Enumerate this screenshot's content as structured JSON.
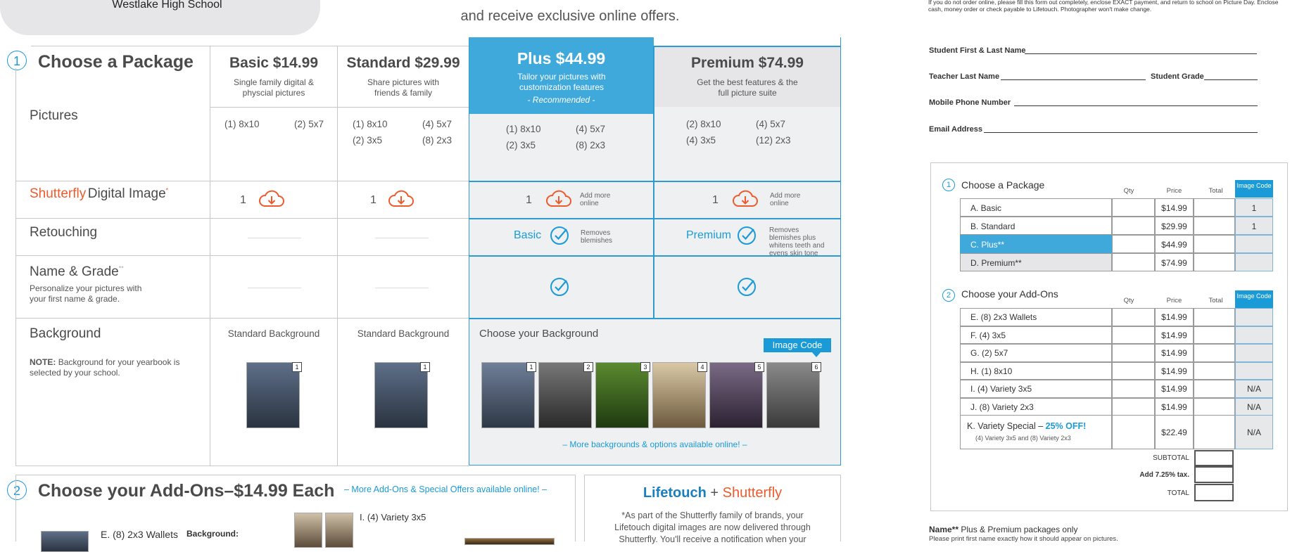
{
  "header": {
    "school": "Westlake High School",
    "subtitle": "and receive exclusive online offers."
  },
  "section1": {
    "num": "1",
    "title": "Choose a Package",
    "rows": {
      "pictures": "Pictures",
      "digital_brand": "Shutterfly",
      "digital_label": "Digital Image",
      "retouching": "Retouching",
      "name_grade": "Name & Grade",
      "name_grade_desc": "Personalize your pictures with your first name & grade.",
      "background": "Background",
      "bg_note_bold": "NOTE:",
      "bg_note": "Background for your yearbook is selected by your school."
    },
    "packages": [
      {
        "title": "Basic $14.99",
        "desc": "Single family digital & physcial pictures",
        "pics": [
          "(1) 8x10",
          "(2) 5x7"
        ],
        "digital": "1"
      },
      {
        "title": "Standard $29.99",
        "desc": "Share pictures with friends & family",
        "pics": [
          "(1) 8x10",
          "(4) 5x7",
          "(2) 3x5",
          "(8) 2x3"
        ],
        "digital": "1"
      },
      {
        "title": "Plus $44.99",
        "desc": "Tailor your pictures with customization features",
        "recommended": "- Recommended -",
        "pics": [
          "(1) 8x10",
          "(4) 5x7",
          "(2) 3x5",
          "(8) 2x3"
        ],
        "digital": "1",
        "add_more": "Add more online",
        "retouch": "Basic",
        "retouch_desc": "Removes blemishes"
      },
      {
        "title": "Premium $74.99",
        "desc": "Get the best features & the full picture suite",
        "pics": [
          "(2) 8x10",
          "(4) 5x7",
          "(4) 3x5",
          "(12) 2x3"
        ],
        "digital": "1",
        "add_more": "Add more online",
        "retouch": "Premium",
        "retouch_desc": "Removes blemishes plus whitens teeth and evens skin tone"
      }
    ],
    "standard_bg": "Standard Background",
    "choose_bg": "Choose your Background",
    "image_code": "Image Code",
    "more_bg": "– More backgrounds & options available online! –",
    "bg_nums": [
      "1",
      "2",
      "3",
      "4",
      "5",
      "6"
    ]
  },
  "section2": {
    "num": "2",
    "title": "Choose your Add-Ons–$14.99 Each",
    "more": "– More Add-Ons & Special Offers available online! –",
    "item_e": "E. (8) 2x3 Wallets",
    "bg_label": "Background:",
    "item_i": "I. (4) Variety 3x5"
  },
  "lifetouch": {
    "brand1": "Lifetouch",
    "plus": "+",
    "brand2": "Shutterfly",
    "text": "*As part of the Shutterfly family of brands, your Lifetouch digital images are now delivered through Shutterfly. You'll receive a notification when your"
  },
  "form": {
    "notice": "If you do not order online, please fill this form out completely, enclose EXACT payment, and return to school on Picture Day. Enclose cash, money order or check payable to Lifetouch. Photographer won't make change.",
    "student_name": "Student First & Last Name",
    "teacher": "Teacher Last Name",
    "grade": "Student Grade",
    "phone": "Mobile Phone Number",
    "email": "Email Address"
  },
  "order": {
    "s1_num": "1",
    "s1_title": "Choose a Package",
    "s2_num": "2",
    "s2_title": "Choose your Add-Ons",
    "col_qty": "Qty",
    "col_price": "Price",
    "col_total": "Total",
    "col_code": "Image Code",
    "packages": [
      {
        "label": "A. Basic",
        "price": "$14.99",
        "code": "1"
      },
      {
        "label": "B. Standard",
        "price": "$29.99",
        "code": "1"
      },
      {
        "label": "C. Plus**",
        "price": "$44.99",
        "code": ""
      },
      {
        "label": "D. Premium**",
        "price": "$74.99",
        "code": ""
      }
    ],
    "addons": [
      {
        "label": "E. (8) 2x3 Wallets",
        "price": "$14.99",
        "code": ""
      },
      {
        "label": "F. (4) 3x5",
        "price": "$14.99",
        "code": ""
      },
      {
        "label": "G. (2) 5x7",
        "price": "$14.99",
        "code": ""
      },
      {
        "label": "H. (1) 8x10",
        "price": "$14.99",
        "code": ""
      },
      {
        "label": "I. (4) Variety 3x5",
        "price": "$14.99",
        "code": "N/A"
      },
      {
        "label": "J. (8) Variety 2x3",
        "price": "$14.99",
        "code": "N/A"
      }
    ],
    "special_label": "K. Variety Special –",
    "special_off": "25% OFF!",
    "special_sub": "(4) Variety 3x5 and (8) Variety 2x3",
    "special_price": "$22.49",
    "special_code": "N/A",
    "subtotal": "SUBTOTAL",
    "tax": "Add 7.25% tax.",
    "total": "TOTAL"
  },
  "footnote": {
    "bold": "Name**",
    "text": "Plus & Premium packages only",
    "sub": "Please print first name exactly how it should appear on pictures."
  }
}
